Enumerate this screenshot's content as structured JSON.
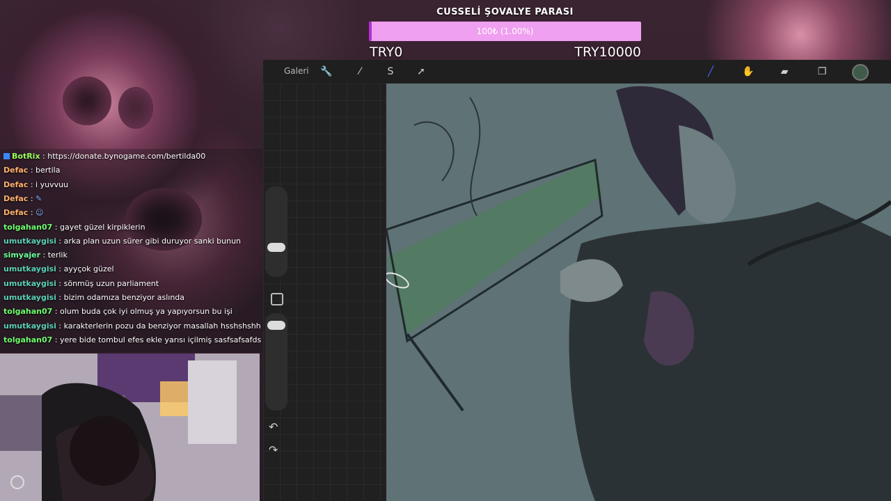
{
  "goal": {
    "title": "CUSSELİ ŞOVALYE PARASI",
    "progress_text": "100₺ (1.00%)",
    "progress_fraction": 0.01,
    "min_label": "TRY0",
    "max_label": "TRY10000",
    "fill_color": "#b12fd8",
    "bar_color": "#f0a0f0"
  },
  "procreate": {
    "gallery_label": "Galeri",
    "tools_left": [
      "wrench-icon",
      "magic-wand-icon",
      "selection-icon",
      "move-arrow-icon"
    ],
    "tools_right": [
      "brush-icon",
      "smudge-icon",
      "eraser-icon",
      "layers-icon",
      "color-swatch"
    ],
    "active_color": "#3f5a49",
    "undo": "↶",
    "redo": "↷"
  },
  "chat": {
    "messages": [
      {
        "user": "BotRix",
        "user_color": "#9aff5e",
        "text": "https://donate.bynogame.com/bertilda00"
      },
      {
        "user": "Defac",
        "user_color": "#ffb06b",
        "text": "bertila"
      },
      {
        "user": "Defac",
        "user_color": "#ffb06b",
        "text": "i yuvvuu"
      },
      {
        "user": "Defac",
        "user_color": "#ffb06b",
        "text": ""
      },
      {
        "user": "Defac",
        "user_color": "#ffb06b",
        "text": ""
      },
      {
        "user": "tolgahan07",
        "user_color": "#6bff6b",
        "text": "gayet güzel kirpiklerin"
      },
      {
        "user": "umutkaygisi",
        "user_color": "#5ad1b8",
        "text": "arka plan uzun sürer gibi duruyor sanki bunun"
      },
      {
        "user": "simyajer",
        "user_color": "#6bff9a",
        "text": "terlik"
      },
      {
        "user": "umutkaygisi",
        "user_color": "#5ad1b8",
        "text": "ayyçok güzel"
      },
      {
        "user": "umutkaygisi",
        "user_color": "#5ad1b8",
        "text": "sönmüş uzun parliament"
      },
      {
        "user": "umutkaygisi",
        "user_color": "#5ad1b8",
        "text": "bizim odamıza benziyor aslında"
      },
      {
        "user": "tolgahan07",
        "user_color": "#6bff6b",
        "text": "olum buda çok iyi olmuş ya yapıyorsun bu işi"
      },
      {
        "user": "umutkaygisi",
        "user_color": "#5ad1b8",
        "text": "karakterlerin pozu da benziyor masallah hsshshshh"
      },
      {
        "user": "tolgahan07",
        "user_color": "#6bff6b",
        "text": "yere bide tombul efes ekle yarısı içilmiş sasfsafsafds"
      }
    ]
  }
}
